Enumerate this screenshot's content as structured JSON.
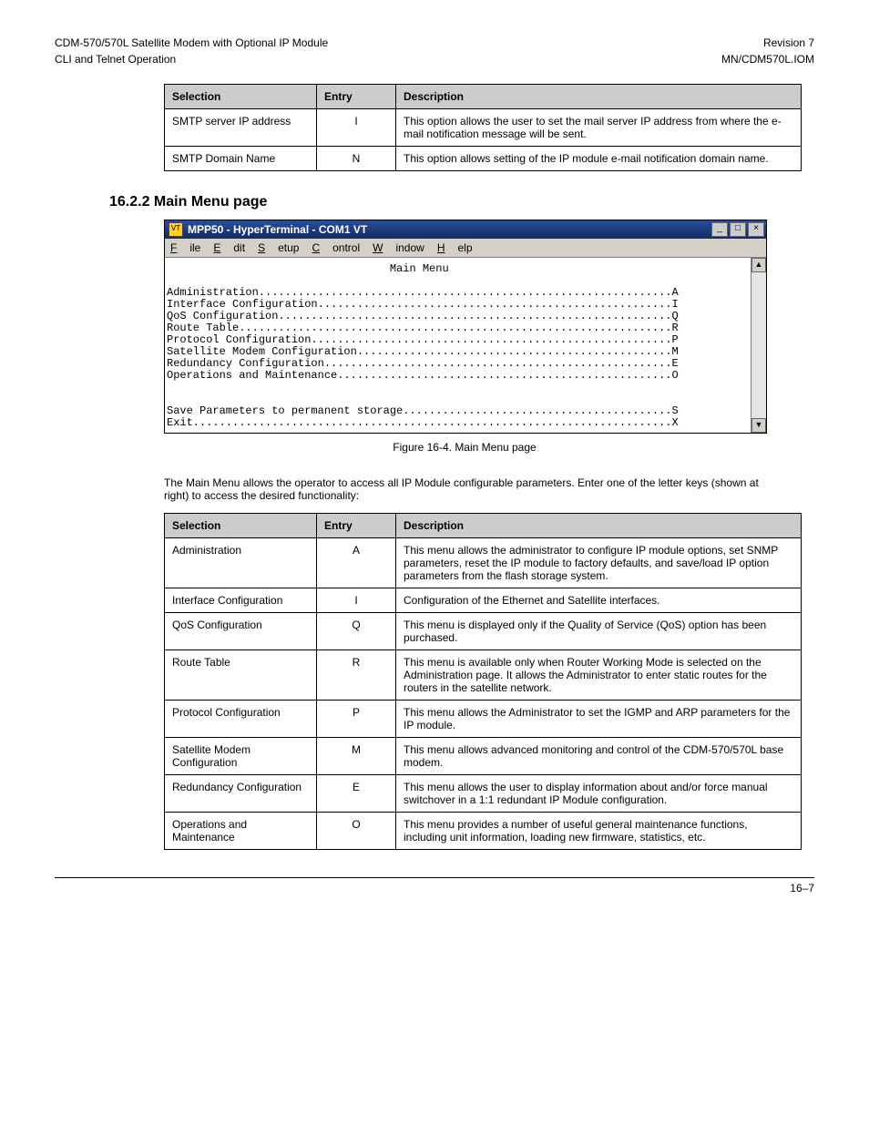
{
  "header": {
    "left": "CDM-570/570L Satellite Modem with Optional IP Module",
    "right": "Revision 7"
  },
  "subheader": {
    "left": "CLI and Telnet Operation",
    "right": "MN/CDM570L.IOM"
  },
  "table1": {
    "headers": [
      "Selection",
      "Entry",
      "Description"
    ],
    "rows": [
      {
        "selection": "SMTP server IP address",
        "entry": "I",
        "description": "This option allows the user to set the mail server IP address from where the e-mail notification message will be sent."
      },
      {
        "selection": "SMTP Domain Name",
        "entry": "N",
        "description": "This option allows setting of the IP module e-mail notification domain name."
      }
    ]
  },
  "subhead": "16.2.2  Main Menu page",
  "window": {
    "title": "MPP50 - HyperTerminal - COM1 VT",
    "menus": [
      {
        "label": "File",
        "uidx": 0
      },
      {
        "label": "Edit",
        "uidx": 0
      },
      {
        "label": "Setup",
        "uidx": 0
      },
      {
        "label": "Control",
        "uidx": 0
      },
      {
        "label": "Window",
        "uidx": 0
      },
      {
        "label": "Help",
        "uidx": 0
      }
    ]
  },
  "terminal": {
    "heading": "Main Menu",
    "lines": [
      {
        "label": "Administration",
        "key": "A"
      },
      {
        "label": "Interface Configuration",
        "key": "I"
      },
      {
        "label": "QoS Configuration",
        "key": "Q"
      },
      {
        "label": "Route Table",
        "key": "R"
      },
      {
        "label": "Protocol Configuration",
        "key": "P"
      },
      {
        "label": "Satellite Modem Configuration",
        "key": "M"
      },
      {
        "label": "Redundancy Configuration",
        "key": "E"
      },
      {
        "label": "Operations and Maintenance",
        "key": "O"
      }
    ],
    "tail": [
      {
        "label": "Save Parameters to permanent storage",
        "key": "S"
      },
      {
        "label": "Exit",
        "key": "X"
      }
    ]
  },
  "fig_caption": "Figure 16-4. Main Menu page",
  "intro_para": "The Main Menu allows the operator to access all IP Module configurable parameters. Enter one of the letter keys (shown at right) to access the desired functionality:",
  "table2": {
    "headers": [
      "Selection",
      "Entry",
      "Description"
    ],
    "rows": [
      {
        "selection": "Administration",
        "entry": "A",
        "description": "This menu allows the administrator to configure IP module options, set SNMP parameters, reset the IP module to factory defaults, and save/load IP option parameters from the flash storage system."
      },
      {
        "selection": "Interface Configuration",
        "entry": "I",
        "description": "Configuration of the Ethernet and Satellite interfaces."
      },
      {
        "selection": "QoS Configuration",
        "entry": "Q",
        "description": "This menu is displayed only if the Quality of Service (QoS) option has been purchased."
      },
      {
        "selection": "Route Table",
        "entry": "R",
        "description": "This menu is available only when Router Working Mode is selected on the Administration page. It allows the Administrator to enter static routes for the routers in the satellite network."
      },
      {
        "selection": "Protocol Configuration",
        "entry": "P",
        "description": "This menu allows the Administrator to set the IGMP and ARP parameters for the IP module."
      },
      {
        "selection": "Satellite Modem Configuration",
        "entry": "M",
        "description": "This menu allows advanced monitoring and control of the CDM-570/570L base modem."
      },
      {
        "selection": "Redundancy Configuration",
        "entry": "E",
        "description": "This menu allows the user to display information about and/or force manual switchover in a 1:1 redundant IP Module configuration."
      },
      {
        "selection": "Operations and Maintenance",
        "entry": "O",
        "description": "This menu provides a number of useful general maintenance functions, including unit information, loading new firmware, statistics, etc."
      }
    ]
  },
  "page_number": "16–7"
}
